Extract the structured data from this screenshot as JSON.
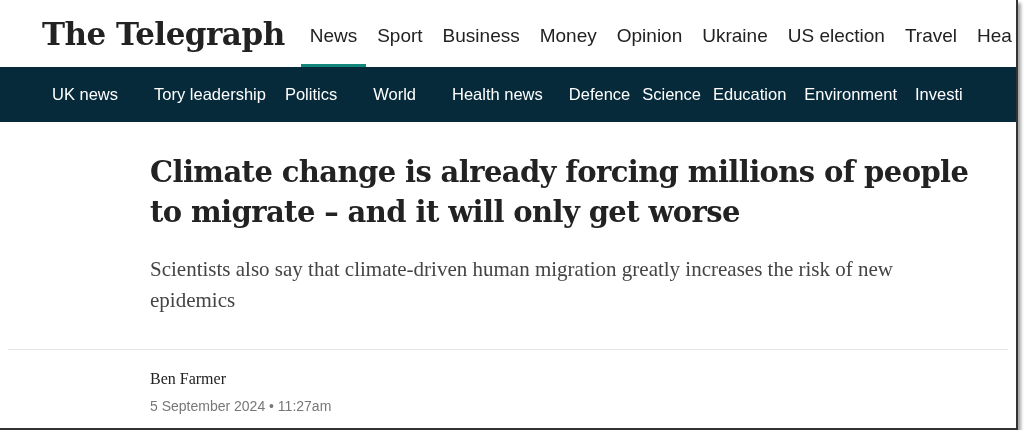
{
  "logo": "The Telegraph",
  "main_nav": [
    {
      "label": "News",
      "selected": true
    },
    {
      "label": "Sport",
      "selected": false
    },
    {
      "label": "Business",
      "selected": false
    },
    {
      "label": "Money",
      "selected": false
    },
    {
      "label": "Opinion",
      "selected": false
    },
    {
      "label": "Ukraine",
      "selected": false
    },
    {
      "label": "US election",
      "selected": false
    },
    {
      "label": "Travel",
      "selected": false
    },
    {
      "label": "Hea",
      "selected": false
    }
  ],
  "sub_nav": [
    "UK news",
    "Tory leadership",
    "Politics",
    "World",
    "Health news",
    "Defence",
    "Science",
    "Education",
    "Environment",
    "Investi"
  ],
  "article": {
    "headline": "Climate change is already forcing millions of people to migrate – and it will only get worse",
    "standfirst": "Scientists also say that climate-driven human migration greatly increases the risk of new epidemics",
    "author": "Ben Farmer",
    "date": "5 September 2024 • 11:27am"
  }
}
